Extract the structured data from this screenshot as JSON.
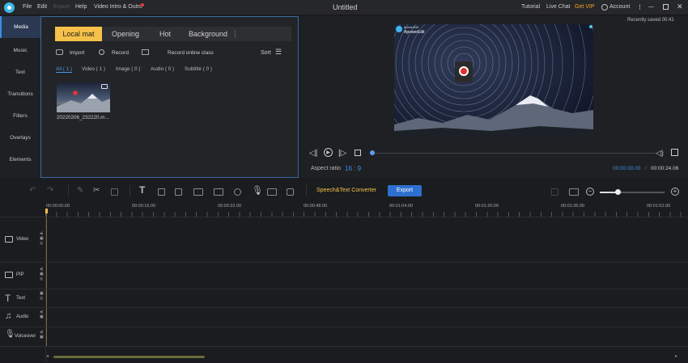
{
  "menu": {
    "file": "File",
    "edit": "Edit",
    "export": "Export",
    "help": "Help",
    "video_intro": "Video Intro & Outro"
  },
  "window": {
    "title": "Untitled",
    "tutorial": "Tutorial",
    "live_chat": "Live Chat",
    "get_vip": "Get VIP",
    "account": "Account",
    "recently_saved": "Recently saved 00:41"
  },
  "sidebar": {
    "items": [
      {
        "label": "Media"
      },
      {
        "label": "Music"
      },
      {
        "label": "Text"
      },
      {
        "label": "Transitions"
      },
      {
        "label": "Filters"
      },
      {
        "label": "Overlays"
      },
      {
        "label": "Elements"
      }
    ]
  },
  "media": {
    "tabs": [
      {
        "label": "Local mat"
      },
      {
        "label": "Opening"
      },
      {
        "label": "Hot"
      },
      {
        "label": "Background"
      }
    ],
    "import": "Import",
    "record": "Record",
    "record_online": "Record online class",
    "sort": "Sort",
    "filters": [
      {
        "label": "All ( 1 )"
      },
      {
        "label": "Video ( 1 )"
      },
      {
        "label": "Image ( 0 )"
      },
      {
        "label": "Audio ( 0 )"
      },
      {
        "label": "Subtitle ( 0 )"
      }
    ],
    "file_name": "20220206_232220.m..."
  },
  "preview": {
    "overlay_small": "ApowerEdit",
    "overlay_brand": "ApowerEdit",
    "aspect_label": "Aspect ratio",
    "aspect_value": "16 : 9",
    "time_current": "00:00:00.00",
    "time_total": "00:00:24.06"
  },
  "toolbar": {
    "speech_text": "Speech&Text Converter",
    "export": "Export"
  },
  "ruler": [
    "00:00:00.00",
    "00:00:16.00",
    "00:00:32.00",
    "00:00:48.00",
    "00:01:04.00",
    "00:01:20.00",
    "00:01:36.00",
    "00:01:52.00"
  ],
  "tracks": [
    {
      "label": "Video"
    },
    {
      "label": "PIP"
    },
    {
      "label": "Text"
    },
    {
      "label": "Audio"
    },
    {
      "label": "Voiceover"
    }
  ],
  "colors": {
    "accent_yellow": "#f5c14a",
    "accent_blue": "#3d8ee6",
    "export_btn": "#2e6fd0"
  }
}
